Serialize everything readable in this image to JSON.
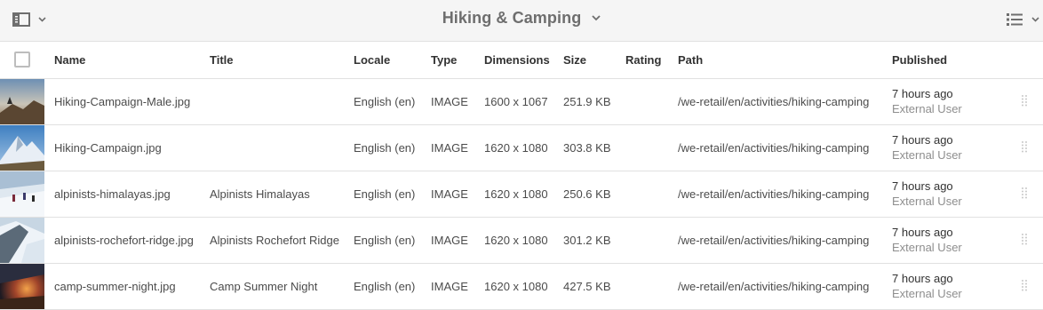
{
  "header": {
    "title": "Hiking & Camping",
    "rail_icon": "rail-toggle-icon",
    "view_icon": "list-view-icon"
  },
  "columns": {
    "name": "Name",
    "title": "Title",
    "locale": "Locale",
    "type": "Type",
    "dimensions": "Dimensions",
    "size": "Size",
    "rating": "Rating",
    "path": "Path",
    "published": "Published"
  },
  "rows": [
    {
      "thumb": "mountain-climber-sunset",
      "name": "Hiking-Campaign-Male.jpg",
      "title": "",
      "locale": "English (en)",
      "type": "IMAGE",
      "dimensions": "1600 x 1067",
      "size": "251.9 KB",
      "rating": "",
      "path": "/we-retail/en/activities/hiking-camping",
      "published_time": "7 hours ago",
      "published_by": "External User"
    },
    {
      "thumb": "snowy-peak-blue-sky",
      "name": "Hiking-Campaign.jpg",
      "title": "",
      "locale": "English (en)",
      "type": "IMAGE",
      "dimensions": "1620 x 1080",
      "size": "303.8 KB",
      "rating": "",
      "path": "/we-retail/en/activities/hiking-camping",
      "published_time": "7 hours ago",
      "published_by": "External User"
    },
    {
      "thumb": "alpinists-on-snow",
      "name": "alpinists-himalayas.jpg",
      "title": "Alpinists Himalayas",
      "locale": "English (en)",
      "type": "IMAGE",
      "dimensions": "1620 x 1080",
      "size": "250.6 KB",
      "rating": "",
      "path": "/we-retail/en/activities/hiking-camping",
      "published_time": "7 hours ago",
      "published_by": "External User"
    },
    {
      "thumb": "icy-ridge",
      "name": "alpinists-rochefort-ridge.jpg",
      "title": "Alpinists Rochefort Ridge",
      "locale": "English (en)",
      "type": "IMAGE",
      "dimensions": "1620 x 1080",
      "size": "301.2 KB",
      "rating": "",
      "path": "/we-retail/en/activities/hiking-camping",
      "published_time": "7 hours ago",
      "published_by": "External User"
    },
    {
      "thumb": "campfire-night",
      "name": "camp-summer-night.jpg",
      "title": "Camp Summer Night",
      "locale": "English (en)",
      "type": "IMAGE",
      "dimensions": "1620 x 1080",
      "size": "427.5 KB",
      "rating": "",
      "path": "/we-retail/en/activities/hiking-camping",
      "published_time": "7 hours ago",
      "published_by": "External User"
    }
  ]
}
